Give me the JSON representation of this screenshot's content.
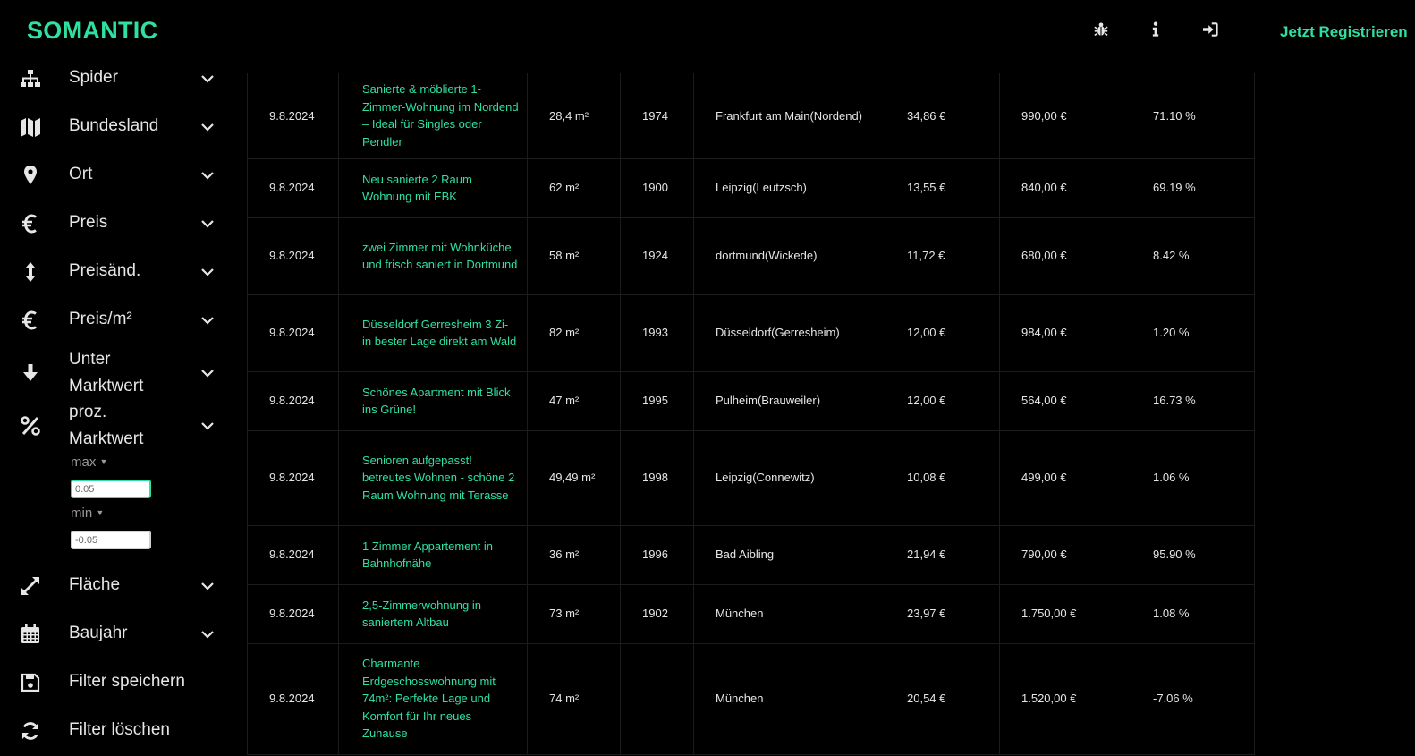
{
  "app": {
    "brand": "SOMANTIC",
    "register_label": "Jetzt Registrieren",
    "accent_color": "#2fe0a0"
  },
  "topbar": {
    "icons": [
      "bug-icon",
      "info-icon",
      "login-icon"
    ]
  },
  "sidebar": {
    "items": [
      {
        "label": "Spider",
        "icon": "sitemap-icon"
      },
      {
        "label": "Bundesland",
        "icon": "map-icon"
      },
      {
        "label": "Ort",
        "icon": "map-marker-icon"
      },
      {
        "label": "Preis",
        "icon": "euro-icon"
      },
      {
        "label": "Preisänd.",
        "icon": "arrows-vertical-icon"
      },
      {
        "label": "Preis/m²",
        "icon": "euro-icon"
      },
      {
        "label": "Unter Marktwert",
        "icon": "arrow-down-icon"
      },
      {
        "label": "proz. Marktwert",
        "icon": "percent-icon"
      },
      {
        "label": "Fläche",
        "icon": "expand-icon"
      },
      {
        "label": "Baujahr",
        "icon": "calendar-icon"
      },
      {
        "label": "Filter speichern",
        "icon": "save-icon"
      },
      {
        "label": "Filter löschen",
        "icon": "refresh-icon"
      }
    ],
    "proz_filter": {
      "max_label": "max",
      "max_value": "0.05",
      "min_label": "min",
      "min_value": "-0.05"
    }
  },
  "table": {
    "rows": [
      {
        "date": "9.8.2024",
        "title": "Sanierte & möblierte 1-Zimmer-Wohnung im Nordend – Ideal für Singles oder Pendler",
        "area": "28,4 m²",
        "year": "1974",
        "location": "Frankfurt am Main(Nordend)",
        "price_per_m2": "34,86 €",
        "price": "990,00 €",
        "percent": "71.10 %"
      },
      {
        "date": "9.8.2024",
        "title": "Neu sanierte 2 Raum Wohnung mit EBK",
        "area": "62 m²",
        "year": "1900",
        "location": "Leipzig(Leutzsch)",
        "price_per_m2": "13,55 €",
        "price": "840,00 €",
        "percent": "69.19 %"
      },
      {
        "date": "9.8.2024",
        "title": "zwei Zimmer mit Wohnküche und frisch saniert in Dortmund",
        "area": "58 m²",
        "year": "1924",
        "location": "dortmund(Wickede)",
        "price_per_m2": "11,72 €",
        "price": "680,00 €",
        "percent": "8.42 %"
      },
      {
        "date": "9.8.2024",
        "title": "Düsseldorf Gerresheim 3 Zi- in bester Lage direkt am Wald",
        "area": "82 m²",
        "year": "1993",
        "location": "Düsseldorf(Gerresheim)",
        "price_per_m2": "12,00 €",
        "price": "984,00 €",
        "percent": "1.20 %"
      },
      {
        "date": "9.8.2024",
        "title": "Schönes Apartment mit Blick ins Grüne!",
        "area": "47 m²",
        "year": "1995",
        "location": "Pulheim(Brauweiler)",
        "price_per_m2": "12,00 €",
        "price": "564,00 €",
        "percent": "16.73 %"
      },
      {
        "date": "9.8.2024",
        "title": "Senioren aufgepasst! betreutes Wohnen - schöne 2 Raum Wohnung mit Terasse",
        "area": "49,49 m²",
        "year": "1998",
        "location": "Leipzig(Connewitz)",
        "price_per_m2": "10,08 €",
        "price": "499,00 €",
        "percent": "1.06 %"
      },
      {
        "date": "9.8.2024",
        "title": "1 Zimmer Appartement in Bahnhofnähe",
        "area": "36 m²",
        "year": "1996",
        "location": "Bad Aibling",
        "price_per_m2": "21,94 €",
        "price": "790,00 €",
        "percent": "95.90 %"
      },
      {
        "date": "9.8.2024",
        "title": "2,5-Zimmerwohnung in saniertem Altbau",
        "area": "73 m²",
        "year": "1902",
        "location": "München",
        "price_per_m2": "23,97 €",
        "price": "1.750,00 €",
        "percent": "1.08 %"
      },
      {
        "date": "9.8.2024",
        "title": "Charmante Erdgeschosswohnung mit 74m²: Perfekte Lage und Komfort für Ihr neues Zuhause",
        "area": "74 m²",
        "year": "",
        "location": "München",
        "price_per_m2": "20,54 €",
        "price": "1.520,00 €",
        "percent": "-7.06 %"
      }
    ]
  }
}
